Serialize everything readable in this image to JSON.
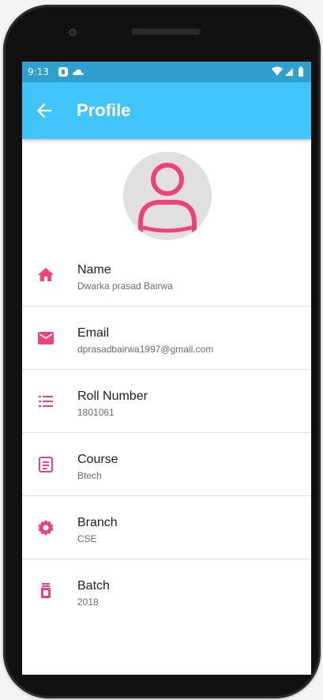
{
  "status_bar": {
    "time": "9:13",
    "icons": [
      "app-notification-icon",
      "cloud-icon",
      "wifi-icon",
      "signal-icon",
      "battery-icon"
    ]
  },
  "app_bar": {
    "title": "Profile",
    "back_icon": "arrow-back-icon"
  },
  "colors": {
    "status_bar": "#2f9fd0",
    "app_bar": "#40c4fa",
    "accent": "#f0417f",
    "avatar_bg": "#e0e0e0"
  },
  "profile": {
    "avatar_icon": "person-outline-icon",
    "fields": [
      {
        "label": "Name",
        "value": "Dwarka prasad Bairwa",
        "icon": "home-icon"
      },
      {
        "label": "Email",
        "value": "dprasadbairwa1997@gmail.com",
        "icon": "email-icon"
      },
      {
        "label": "Roll Number",
        "value": "1801061",
        "icon": "list-icon"
      },
      {
        "label": "Course",
        "value": "Btech",
        "icon": "document-icon"
      },
      {
        "label": "Branch",
        "value": "CSE",
        "icon": "gear-icon"
      },
      {
        "label": "Batch",
        "value": "2018",
        "icon": "hourglass-icon"
      }
    ]
  },
  "nav_bar": {
    "buttons": [
      "back-triangle-icon",
      "home-circle-icon",
      "recents-square-icon"
    ]
  }
}
